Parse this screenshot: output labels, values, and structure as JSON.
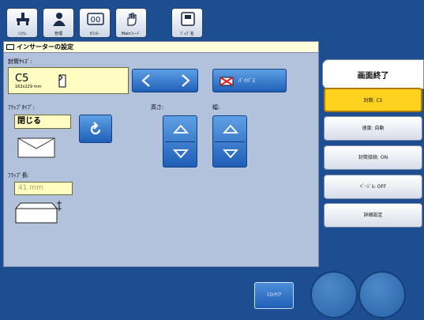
{
  "toolbar": {
    "buttons": [
      {
        "label": "ｼｽﾃﾑ",
        "icon": "system-icon"
      },
      {
        "label": "管理",
        "icon": "admin-user-icon"
      },
      {
        "label": "ｶｳﾝﾀｰ",
        "icon": "counter-icon"
      },
      {
        "label": "Mainﾌｨｰﾄﾞ",
        "icon": "hand-feed-icon"
      },
      {
        "label": "ｼﾞｮﾌﾞ名",
        "icon": "job-icon"
      }
    ]
  },
  "panel": {
    "title": "インサーターの設定",
    "envelope_size_label": "封筒ｻｲｽﾞ:",
    "envelope_size_value": "C5",
    "envelope_size_dims": "162x229 mm",
    "bypass_label": "ﾊﾞｲﾊﾟｽ",
    "flap_type_label": "ﾌﾗｯﾌﾟﾀｲﾌﾟ:",
    "flap_type_value": "閉じる",
    "height_label": "高さ:",
    "width_label": "幅:",
    "flap_length_label": "ﾌﾗｯﾌﾟ長:",
    "flap_length_value": "41 mm"
  },
  "right": {
    "exit_label": "画面終了",
    "items": [
      {
        "label": "封筒: C5"
      },
      {
        "label": "速度: 自動"
      },
      {
        "label": "封筒接続: ON"
      },
      {
        "label": "ﾍﾟｰｼﾞﾙ: OFF"
      },
      {
        "label": "詳細設定"
      }
    ]
  },
  "bottom": {
    "test_button_label": "ﾃｽﾄｸﾘｱ"
  },
  "colors": {
    "background": "#1d4e92",
    "panel": "#b2c1dc",
    "accent_yellow": "#ffd21f",
    "button_blue": "#2f74cf"
  }
}
